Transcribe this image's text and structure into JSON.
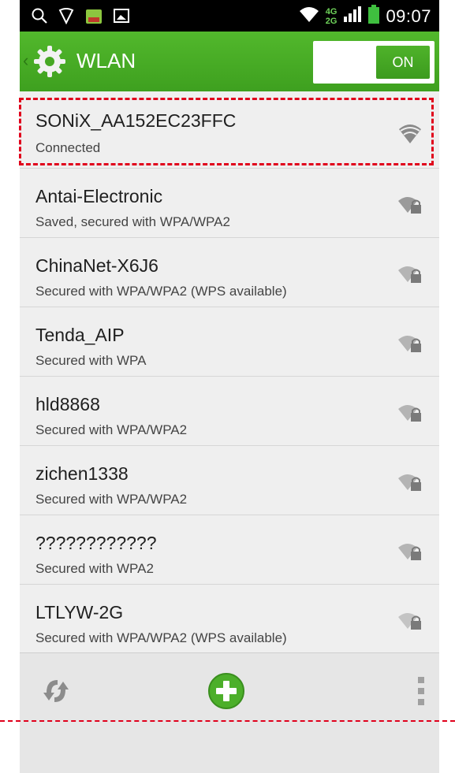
{
  "status_bar": {
    "time": "09:07",
    "net_top": "4G",
    "net_bottom": "2G",
    "icons": [
      "search-icon",
      "location-icon",
      "app-icon",
      "image-icon",
      "wifi-icon",
      "signal-icon",
      "battery-icon"
    ]
  },
  "action_bar": {
    "title": "WLAN",
    "toggle_label": "ON",
    "accent": "#46a823"
  },
  "networks": [
    {
      "ssid": "SONiX_AA152EC23FFC",
      "status": "Connected",
      "locked": false
    },
    {
      "ssid": "Antai-Electronic",
      "status": "Saved, secured with WPA/WPA2",
      "locked": true
    },
    {
      "ssid": "ChinaNet-X6J6",
      "status": "Secured with WPA/WPA2 (WPS available)",
      "locked": true
    },
    {
      "ssid": "Tenda_AIP",
      "status": "Secured with WPA",
      "locked": true
    },
    {
      "ssid": "hld8868",
      "status": "Secured with WPA/WPA2",
      "locked": true
    },
    {
      "ssid": "zichen1338",
      "status": "Secured with WPA/WPA2",
      "locked": true
    },
    {
      "ssid": "????????????",
      "status": "Secured with WPA2",
      "locked": true
    },
    {
      "ssid": "LTLYW-2G",
      "status": "Secured with WPA/WPA2 (WPS available)",
      "locked": true
    }
  ],
  "bottom_bar": {
    "icons": [
      "refresh-icon",
      "add-network-icon",
      "overflow-menu-icon"
    ]
  },
  "annotation_color": "#e0001b"
}
